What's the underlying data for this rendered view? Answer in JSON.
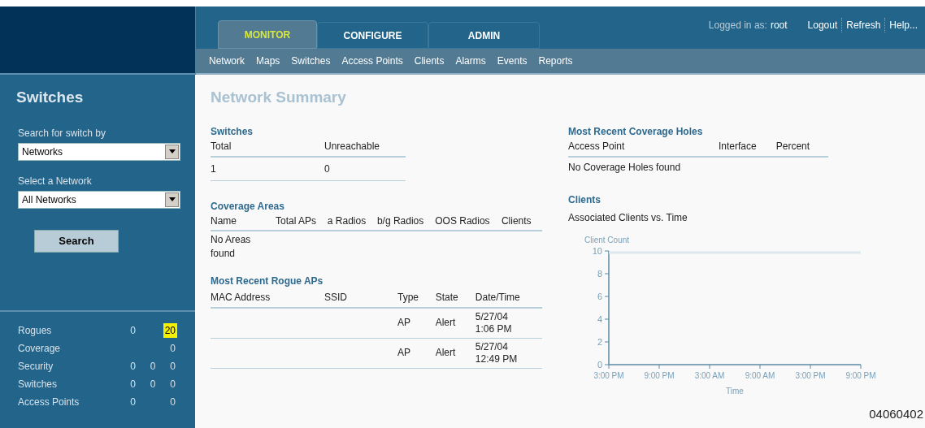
{
  "header": {
    "tabs": [
      {
        "label": "MONITOR",
        "selected": true
      },
      {
        "label": "CONFIGURE",
        "selected": false
      },
      {
        "label": "ADMIN",
        "selected": false
      }
    ],
    "login_label": "Logged in as:",
    "user": "root",
    "links": [
      "Logout",
      "Refresh",
      "Help..."
    ],
    "subnav": [
      "Network",
      "Maps",
      "Switches",
      "Access Points",
      "Clients",
      "Alarms",
      "Events",
      "Reports"
    ]
  },
  "sidebar": {
    "title": "Switches",
    "search_by_label": "Search for switch by",
    "search_by_value": "Networks",
    "network_label": "Select a Network",
    "network_value": "All Networks",
    "search_button": "Search",
    "stats": [
      {
        "label": "Rogues",
        "values": {
          "col_1": {
            "text": "0",
            "highlight": false
          },
          "col_3": {
            "text": "20",
            "highlight": true
          }
        }
      },
      {
        "label": "Coverage",
        "values": {
          "col_3": {
            "text": "0",
            "highlight": false
          }
        }
      },
      {
        "label": "Security",
        "values": {
          "col_1": {
            "text": "0",
            "highlight": false
          },
          "col_2": {
            "text": "0",
            "highlight": false
          },
          "col_3": {
            "text": "0",
            "highlight": false
          }
        }
      },
      {
        "label": "Switches",
        "values": {
          "col_1": {
            "text": "0",
            "highlight": false
          },
          "col_2": {
            "text": "0",
            "highlight": false
          },
          "col_3": {
            "text": "0",
            "highlight": false
          }
        }
      },
      {
        "label": "Access Points",
        "values": {
          "col_1": {
            "text": "0",
            "highlight": false
          },
          "col_3": {
            "text": "0",
            "highlight": false
          }
        }
      }
    ]
  },
  "page_title": "Network Summary",
  "switches": {
    "title": "Switches",
    "columns": [
      "Total",
      "Unreachable"
    ],
    "rows": [
      [
        "1",
        "0"
      ]
    ]
  },
  "coverage_areas": {
    "title": "Coverage Areas",
    "columns": [
      "Name",
      "Total APs",
      "a Radios",
      "b/g Radios",
      "OOS Radios",
      "Clients"
    ],
    "empty": "No Areas found"
  },
  "rogue_aps": {
    "title": "Most Recent Rogue APs",
    "columns": [
      "MAC Address",
      "SSID",
      "Type",
      "State",
      "Date/Time"
    ],
    "rows": [
      [
        "",
        "",
        "AP",
        "Alert",
        "5/27/04 1:06 PM"
      ],
      [
        "",
        "",
        "AP",
        "Alert",
        "5/27/04 12:49 PM"
      ]
    ]
  },
  "coverage_holes": {
    "title": "Most Recent Coverage Holes",
    "columns": [
      "Access Point",
      "Interface",
      "Percent"
    ],
    "empty": "No Coverage Holes found"
  },
  "clients": {
    "title": "Clients",
    "chart_data": {
      "type": "line",
      "title": "Associated Clients vs. Time",
      "ylabel": "Client Count",
      "xlabel": "Time",
      "ylim": [
        0,
        10
      ],
      "yticks": [
        0,
        2,
        4,
        6,
        8,
        10
      ],
      "categories": [
        "3:00 PM",
        "9:00 PM",
        "3:00 AM",
        "9:00 AM",
        "3:00 PM",
        "9:00 PM"
      ]
    }
  },
  "figure_number": "04060402"
}
